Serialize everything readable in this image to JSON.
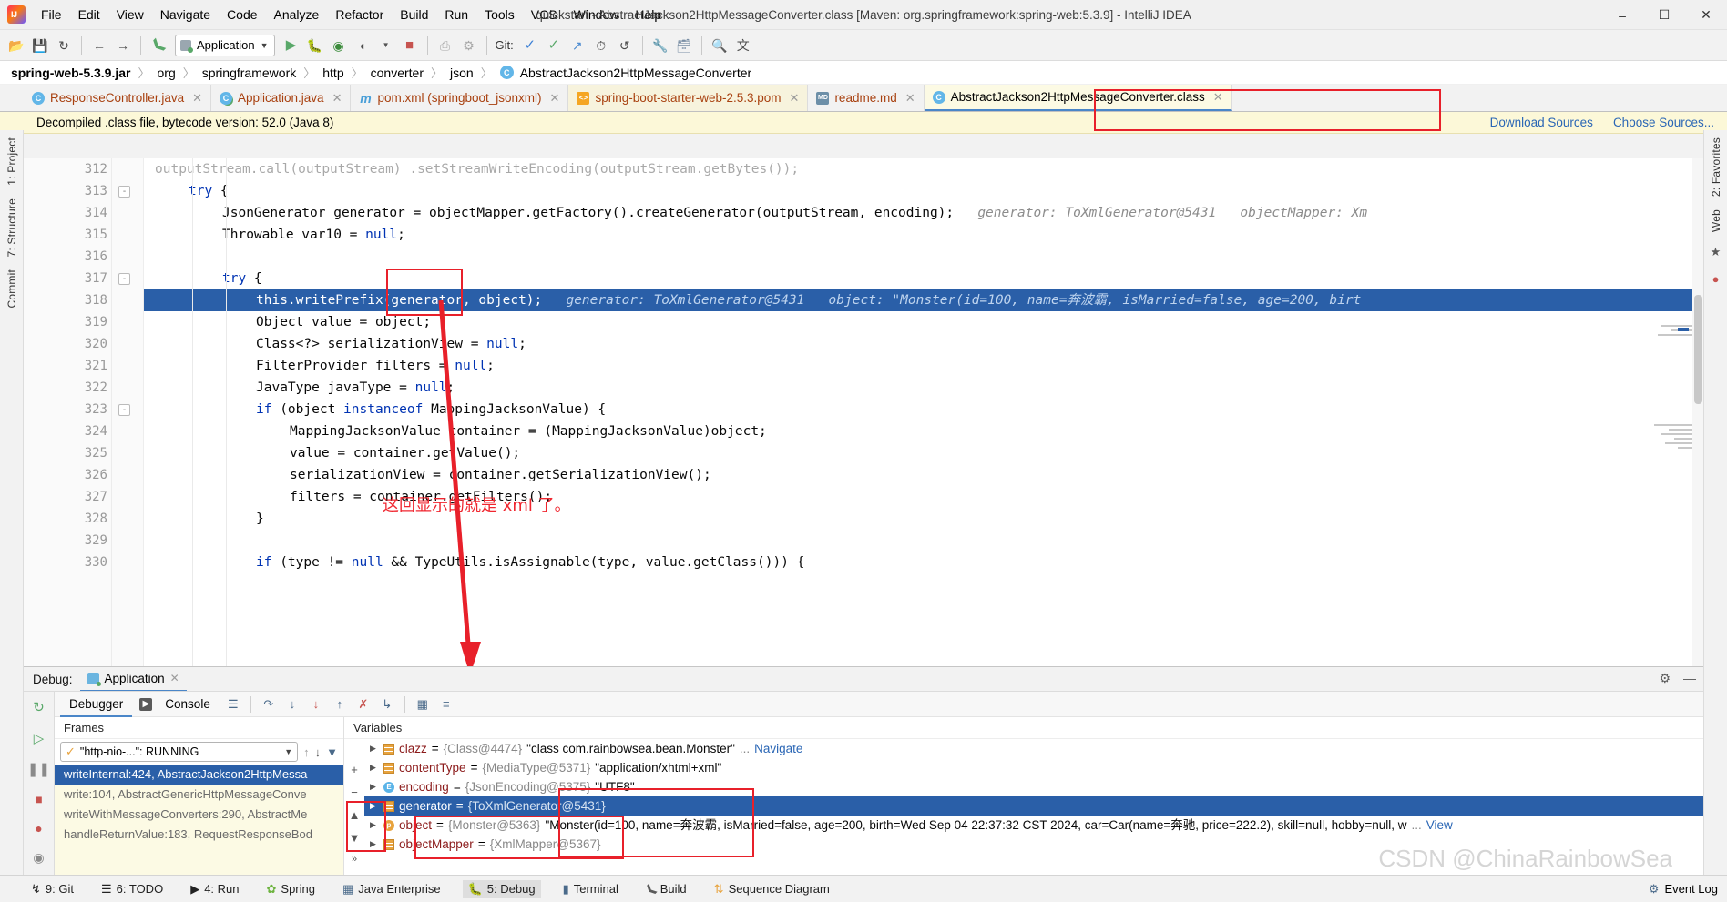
{
  "window": {
    "title": "quickstart - AbstractJackson2HttpMessageConverter.class [Maven: org.springframework:spring-web:5.3.9] - IntelliJ IDEA",
    "minimize": "–",
    "maximize": "☐",
    "close": "✕"
  },
  "menu": [
    "File",
    "Edit",
    "View",
    "Navigate",
    "Code",
    "Analyze",
    "Refactor",
    "Build",
    "Run",
    "Tools",
    "VCS",
    "Window",
    "Help"
  ],
  "toolbar": {
    "run_config": "Application",
    "git_label": "Git:",
    "icons": [
      "open-folder-icon",
      "save-icon",
      "sync-icon",
      "back-arrow-icon",
      "forward-arrow-icon",
      "build-hammer-icon",
      "run-icon",
      "debug-icon",
      "run-coverage-icon",
      "profiler-icon",
      "stop-icon",
      "device-icon",
      "gradle-icon",
      "settings-wrench-icon",
      "project-structure-icon",
      "search-everywhere-icon",
      "translate-icon"
    ]
  },
  "breadcrumb": {
    "items": [
      "spring-web-5.3.9.jar",
      "org",
      "springframework",
      "http",
      "converter",
      "json"
    ],
    "last": "AbstractJackson2HttpMessageConverter",
    "separator": "〉"
  },
  "tabs": [
    {
      "label": "ResponseController.java",
      "icon": "java-class-icon",
      "selected": false
    },
    {
      "label": "Application.java",
      "icon": "java-run-class-icon",
      "selected": false
    },
    {
      "label": "pom.xml (springboot_jsonxml)",
      "icon": "maven-icon",
      "selected": false
    },
    {
      "label": "spring-boot-starter-web-2.5.3.pom",
      "icon": "pom-file-icon",
      "selected": false
    },
    {
      "label": "readme.md",
      "icon": "markdown-icon",
      "selected": false
    },
    {
      "label": "AbstractJackson2HttpMessageConverter.class",
      "icon": "java-class-icon",
      "selected": true
    }
  ],
  "notice": {
    "text": "Decompiled .class file, bytecode version: 52.0 (Java 8)",
    "download_sources": "Download Sources",
    "choose_sources": "Choose Sources..."
  },
  "rails": {
    "left": [
      "1: Project",
      "7: Structure",
      "Commit"
    ],
    "right": [
      "2: Favorites",
      "Web"
    ]
  },
  "editor": {
    "lines": [
      {
        "num": "312",
        "fold": "",
        "indent": 0,
        "parts": [
          {
            "t": "outputStream.call(outputStream) .setStreamWriteEncoding(outputStream.getBytes());",
            "c": "tok"
          }
        ],
        "cut": true
      },
      {
        "num": "313",
        "fold": "-",
        "indent": 1,
        "parts": [
          {
            "t": "try",
            "c": "kw"
          },
          {
            "t": " {",
            "c": "tok"
          }
        ]
      },
      {
        "num": "314",
        "fold": "",
        "indent": 2,
        "parts": [
          {
            "t": "JsonGenerator generator = objectMapper.getFactory().createGenerator(outputStream, encoding);",
            "c": "tok"
          },
          {
            "t": "   generator: ToXmlGenerator@5431   objectMapper: Xm",
            "c": "hint"
          }
        ]
      },
      {
        "num": "315",
        "fold": "",
        "indent": 2,
        "parts": [
          {
            "t": "Throwable var10 = ",
            "c": "tok"
          },
          {
            "t": "null",
            "c": "kw"
          },
          {
            "t": ";",
            "c": "tok"
          }
        ]
      },
      {
        "num": "316",
        "fold": "",
        "indent": 2,
        "parts": []
      },
      {
        "num": "317",
        "fold": "-",
        "indent": 2,
        "parts": [
          {
            "t": "try",
            "c": "kw"
          },
          {
            "t": " {",
            "c": "tok"
          }
        ]
      },
      {
        "num": "318",
        "fold": "",
        "indent": 3,
        "highlight": true,
        "parts": [
          {
            "t": "this.writePrefix(generator, object);",
            "c": "tok"
          },
          {
            "t": "   generator: ToXmlGenerator@5431   object: \"Monster(id=100, name=奔波霸, isMarried=false, age=200, birt",
            "c": "hint"
          }
        ]
      },
      {
        "num": "319",
        "fold": "",
        "indent": 3,
        "parts": [
          {
            "t": "Object value = object;",
            "c": "tok"
          }
        ]
      },
      {
        "num": "320",
        "fold": "",
        "indent": 3,
        "parts": [
          {
            "t": "Class<?> serializationView = ",
            "c": "tok"
          },
          {
            "t": "null",
            "c": "kw"
          },
          {
            "t": ";",
            "c": "tok"
          }
        ]
      },
      {
        "num": "321",
        "fold": "",
        "indent": 3,
        "parts": [
          {
            "t": "FilterProvider filters = ",
            "c": "tok"
          },
          {
            "t": "null",
            "c": "kw"
          },
          {
            "t": ";",
            "c": "tok"
          }
        ]
      },
      {
        "num": "322",
        "fold": "",
        "indent": 3,
        "parts": [
          {
            "t": "JavaType javaType = ",
            "c": "tok"
          },
          {
            "t": "null",
            "c": "kw"
          },
          {
            "t": ";",
            "c": "tok"
          }
        ]
      },
      {
        "num": "323",
        "fold": "-",
        "indent": 3,
        "parts": [
          {
            "t": "if",
            "c": "kw"
          },
          {
            "t": " (object ",
            "c": "tok"
          },
          {
            "t": "instanceof",
            "c": "kw"
          },
          {
            "t": " MappingJacksonValue) {",
            "c": "tok"
          }
        ]
      },
      {
        "num": "324",
        "fold": "",
        "indent": 4,
        "parts": [
          {
            "t": "MappingJacksonValue container = (MappingJacksonValue)object;",
            "c": "tok"
          }
        ]
      },
      {
        "num": "325",
        "fold": "",
        "indent": 4,
        "parts": [
          {
            "t": "value = container.getValue();",
            "c": "tok"
          }
        ]
      },
      {
        "num": "326",
        "fold": "",
        "indent": 4,
        "parts": [
          {
            "t": "serializationView = container.getSerializationView();",
            "c": "tok"
          }
        ]
      },
      {
        "num": "327",
        "fold": "",
        "indent": 4,
        "parts": [
          {
            "t": "filters = container.getFilters();",
            "c": "tok"
          }
        ]
      },
      {
        "num": "328",
        "fold": "",
        "indent": 3,
        "parts": [
          {
            "t": "}",
            "c": "tok"
          }
        ]
      },
      {
        "num": "329",
        "fold": "",
        "indent": 3,
        "parts": []
      },
      {
        "num": "330",
        "fold": "",
        "indent": 3,
        "parts": [
          {
            "t": "if",
            "c": "kw"
          },
          {
            "t": " (type != ",
            "c": "tok"
          },
          {
            "t": "null",
            "c": "kw"
          },
          {
            "t": " && TypeUtils.isAssignable(type, value.getClass())) {",
            "c": "tok"
          }
        ]
      }
    ],
    "annotation": "这回显示的就是 xml 了。"
  },
  "debug": {
    "panel_label": "Debug:",
    "session_tab": "Application",
    "tabs": [
      {
        "label": "Debugger",
        "selected": true
      },
      {
        "label": "Console",
        "selected": false
      }
    ],
    "toolbar_icons": [
      "layout-icon",
      "step-over-icon",
      "step-into-icon",
      "force-step-into-icon",
      "step-out-icon",
      "drop-frame-icon",
      "run-to-cursor-icon",
      "evaluate-icon",
      "mute-breakpoints-icon"
    ],
    "side_icons": [
      "rerun-icon",
      "resume-icon",
      "pause-icon",
      "stop-icon",
      "view-breakpoints-icon",
      "mute-breakpoints-icon"
    ],
    "frames_header": "Frames",
    "variables_header": "Variables",
    "thread": "\"http-nio-...\": RUNNING",
    "frames": [
      {
        "label": "writeInternal:424, AbstractJackson2HttpMessa",
        "selected": true
      },
      {
        "label": "write:104, AbstractGenericHttpMessageConve",
        "selected": false
      },
      {
        "label": "writeWithMessageConverters:290, AbstractMe",
        "selected": false
      },
      {
        "label": "handleReturnValue:183, RequestResponseBod",
        "selected": false
      }
    ],
    "variables": [
      {
        "icon": "object-icon",
        "name": "clazz",
        "eq": " = ",
        "ref": "{Class@4474}",
        "value": "\"class com.rainbowsea.bean.Monster\"",
        "suffix": " ...",
        "link": "Navigate",
        "selected": false
      },
      {
        "icon": "object-icon",
        "name": "contentType",
        "eq": " = ",
        "ref": "{MediaType@5371}",
        "value": "\"application/xhtml+xml\"",
        "suffix": "",
        "link": "",
        "selected": false
      },
      {
        "icon": "enum-icon",
        "name": "encoding",
        "eq": " = ",
        "ref": "{JsonEncoding@5375}",
        "value": "\"UTF8\"",
        "suffix": "",
        "link": "",
        "selected": false
      },
      {
        "icon": "object-icon",
        "name": "generator",
        "eq": " = ",
        "ref": "{ToXmlGenerator@5431}",
        "value": "",
        "suffix": "",
        "link": "",
        "selected": true
      },
      {
        "icon": "primitive-icon",
        "name": "object",
        "eq": " = ",
        "ref": "{Monster@5363}",
        "value": "\"Monster(id=100, name=奔波霸, isMarried=false, age=200, birth=Wed Sep 04 22:37:32 CST 2024, car=Car(name=奔驰, price=222.2), skill=null, hobby=null, w",
        "suffix": " ...",
        "link": "View",
        "selected": false
      },
      {
        "icon": "object-icon",
        "name": "objectMapper",
        "eq": " = ",
        "ref": "{XmlMapper@5367}",
        "value": "",
        "suffix": "",
        "link": "",
        "selected": false
      }
    ]
  },
  "status_bar": {
    "items": [
      {
        "label": "9: Git",
        "icon": "git-branch-icon",
        "selected": false
      },
      {
        "label": "6: TODO",
        "icon": "todo-list-icon",
        "selected": false
      },
      {
        "label": "4: Run",
        "icon": "run-icon",
        "selected": false
      },
      {
        "label": "Spring",
        "icon": "spring-leaf-icon",
        "selected": false
      },
      {
        "label": "Java Enterprise",
        "icon": "java-enterprise-icon",
        "selected": false
      },
      {
        "label": "5: Debug",
        "icon": "debug-bug-icon",
        "selected": true
      },
      {
        "label": "Terminal",
        "icon": "terminal-icon",
        "selected": false
      },
      {
        "label": "Build",
        "icon": "build-hammer-icon",
        "selected": false
      },
      {
        "label": "Sequence Diagram",
        "icon": "sequence-diagram-icon",
        "selected": false
      }
    ],
    "event_log": "Event Log"
  },
  "watermark": "CSDN @ChinaRainbowSea",
  "colors": {
    "selection_blue": "#2a5fa8",
    "annotation_red": "#f0262f",
    "banner_yellow": "#fcf8d8",
    "keyword_blue": "#0033b3"
  }
}
